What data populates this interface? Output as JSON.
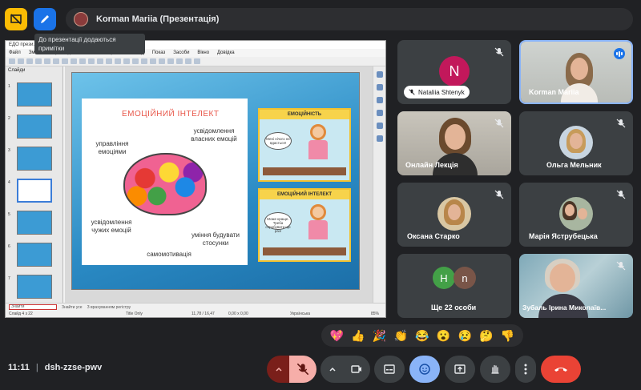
{
  "top_bar": {
    "presenter_name": "Korman Mariia (Презентація)",
    "tooltip": "До презентації додаються примітки"
  },
  "shared_screen": {
    "window_title": "ЕДО прези...",
    "menu": [
      "Файл",
      "Зміни",
      "Перегляд",
      "Вставка",
      "Формат",
      "Слайд",
      "Показ",
      "Засоби",
      "Вікно",
      "Довідка"
    ],
    "slide_pane_title": "Слайди",
    "slide_numbers": [
      "1",
      "2",
      "3",
      "4",
      "5",
      "6",
      "7"
    ],
    "slide": {
      "left_title": "ЕМОЦІЙНИЙ ІНТЕЛЕКТ",
      "labels": {
        "awareness_own": "усвідомлення власних емоцій",
        "managing": "управління емоціями",
        "awareness_others": "усвідомлення чужих емоцій",
        "relationships": "уміння будувати стосунки",
        "self_motivation": "самомотивація"
      },
      "comic_top_title": "ЕМОЦІЙНІСТЬ",
      "comic_top_bubble": "Мені нічого не вдасться!",
      "comic_bottom_title": "ЕМОЦІЙНИЙ ІНТЕЛЕКТ",
      "comic_bottom_bubble": "Може краще. Треба спробувати ще раз!"
    },
    "find_placeholder": "Знайти",
    "find_options": [
      "Знайти усе",
      "З врахуванням регістру"
    ],
    "status": {
      "slide": "Слайд 4 з 22",
      "layout": "Title Only",
      "coords": "11,78 / 16,47",
      "size": "0,00 x 0,00",
      "language": "Українська",
      "zoom": "85%"
    }
  },
  "participants": [
    {
      "name": "Nataliia Shtenyk",
      "initial": "N",
      "muted": true
    },
    {
      "name": "Korman Mariia",
      "speaking": true
    },
    {
      "name": "Онлайн Лекція",
      "muted": true
    },
    {
      "name": "Ольга Мельник",
      "muted": true
    },
    {
      "name": "Оксана Старко",
      "muted": true
    },
    {
      "name": "Марія Яструбецька",
      "muted": true
    },
    {
      "name": "Ще 22 особи",
      "initials": [
        "H",
        "n"
      ]
    },
    {
      "name": "Зубаль Ірина Миколаїв...",
      "muted": true
    }
  ],
  "reactions": [
    "💖",
    "👍",
    "🎉",
    "👏",
    "😂",
    "😮",
    "😢",
    "🤔",
    "👎"
  ],
  "bottom_bar": {
    "time": "11:11",
    "separator": "|",
    "meeting_code": "dsh-zzse-pwv"
  },
  "colors": {
    "background": "#202124",
    "tile": "#3c4043",
    "accent_blue": "#1a73e8",
    "end_call": "#ea4335"
  }
}
